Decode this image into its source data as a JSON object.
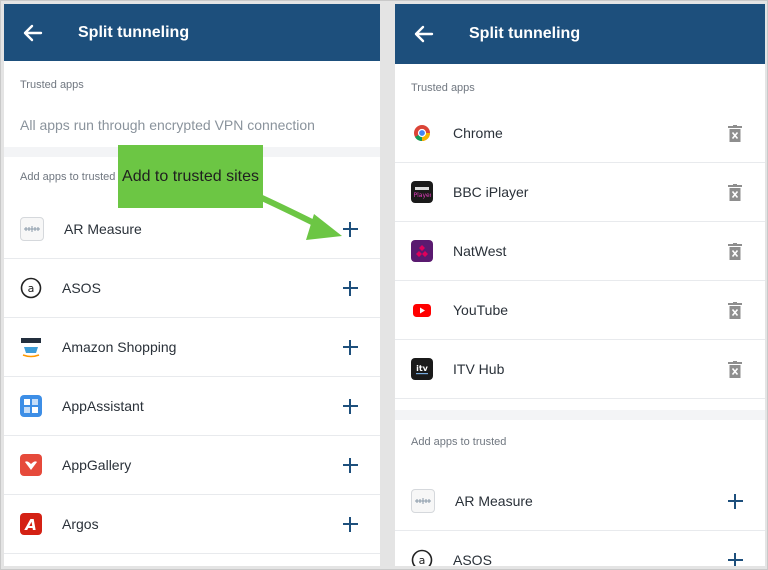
{
  "left": {
    "title": "Split tunneling",
    "trusted_label": "Trusted apps",
    "empty_text": "All apps run through encrypted VPN connection",
    "add_label": "Add apps to trusted",
    "callout": "Add to trusted sites",
    "apps": [
      {
        "name": "AR Measure",
        "icon": "ar-measure-icon"
      },
      {
        "name": "ASOS",
        "icon": "asos-icon"
      },
      {
        "name": "Amazon Shopping",
        "icon": "amazon-icon"
      },
      {
        "name": "AppAssistant",
        "icon": "appassistant-icon"
      },
      {
        "name": "AppGallery",
        "icon": "appgallery-icon"
      },
      {
        "name": "Argos",
        "icon": "argos-icon"
      }
    ]
  },
  "right": {
    "title": "Split tunneling",
    "trusted_label": "Trusted apps",
    "trusted_apps": [
      {
        "name": "Chrome",
        "icon": "chrome-icon"
      },
      {
        "name": "BBC iPlayer",
        "icon": "bbc-iplayer-icon"
      },
      {
        "name": "NatWest",
        "icon": "natwest-icon"
      },
      {
        "name": "YouTube",
        "icon": "youtube-icon"
      },
      {
        "name": "ITV Hub",
        "icon": "itv-hub-icon"
      }
    ],
    "add_label": "Add apps to trusted",
    "apps": [
      {
        "name": "AR Measure",
        "icon": "ar-measure-icon"
      },
      {
        "name": "ASOS",
        "icon": "asos-icon"
      }
    ]
  },
  "colors": {
    "appbar": "#1d4f7c",
    "callout": "#6cc644",
    "arrow": "#6cc644",
    "action": "#1d4f7c",
    "trash": "#8e8e8e"
  }
}
